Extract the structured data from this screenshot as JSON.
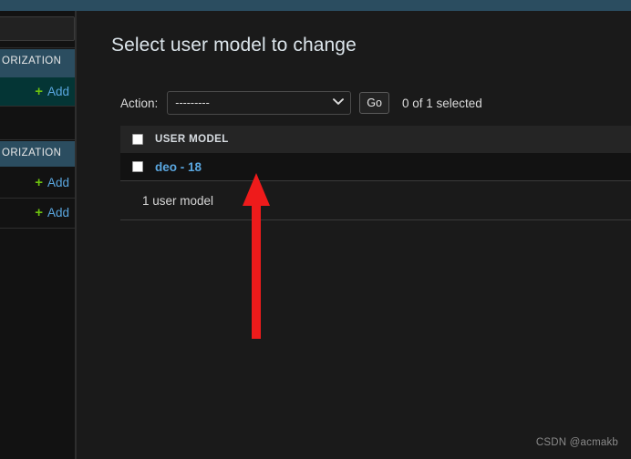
{
  "theme": {
    "brand_bar_color": "#2b4d60",
    "page_background": "#1a1a1a",
    "sidebar_background": "#121212",
    "section_header_color": "#2b4d60",
    "highlight_row_color": "#043535",
    "link_color": "#5aa7e0",
    "add_plus_color": "#6ec20f",
    "annotation_arrow_color": "#ee1b1b"
  },
  "sidebar": {
    "search_placeholder": "",
    "sections": [
      {
        "header": "ORIZATION",
        "header_full_clipped": true,
        "items": [
          {
            "plus": "+",
            "label": "Add",
            "highlighted": true
          }
        ]
      },
      {
        "header": "ORIZATION",
        "items": [
          {
            "plus": "+",
            "label": "Add",
            "highlighted": false
          },
          {
            "plus": "+",
            "label": "Add",
            "highlighted": false
          }
        ]
      }
    ],
    "add_label": "Add",
    "plus_glyph": "+"
  },
  "main": {
    "page_title": "Select user model to change",
    "action_bar": {
      "label": "Action:",
      "select_value": "---------",
      "select_options": [
        "---------"
      ],
      "go_label": "Go",
      "selected_count_text": "0 of 1 selected"
    },
    "table": {
      "columns": [
        "USER MODEL"
      ],
      "rows": [
        {
          "link_text": "deo - 18",
          "checked": false
        }
      ],
      "header_checkbox_checked": false
    },
    "summary": "1 user model"
  },
  "annotation": {
    "type": "arrow",
    "direction": "up",
    "points_at": "deo - 18"
  },
  "watermark": "CSDN @acmakb"
}
